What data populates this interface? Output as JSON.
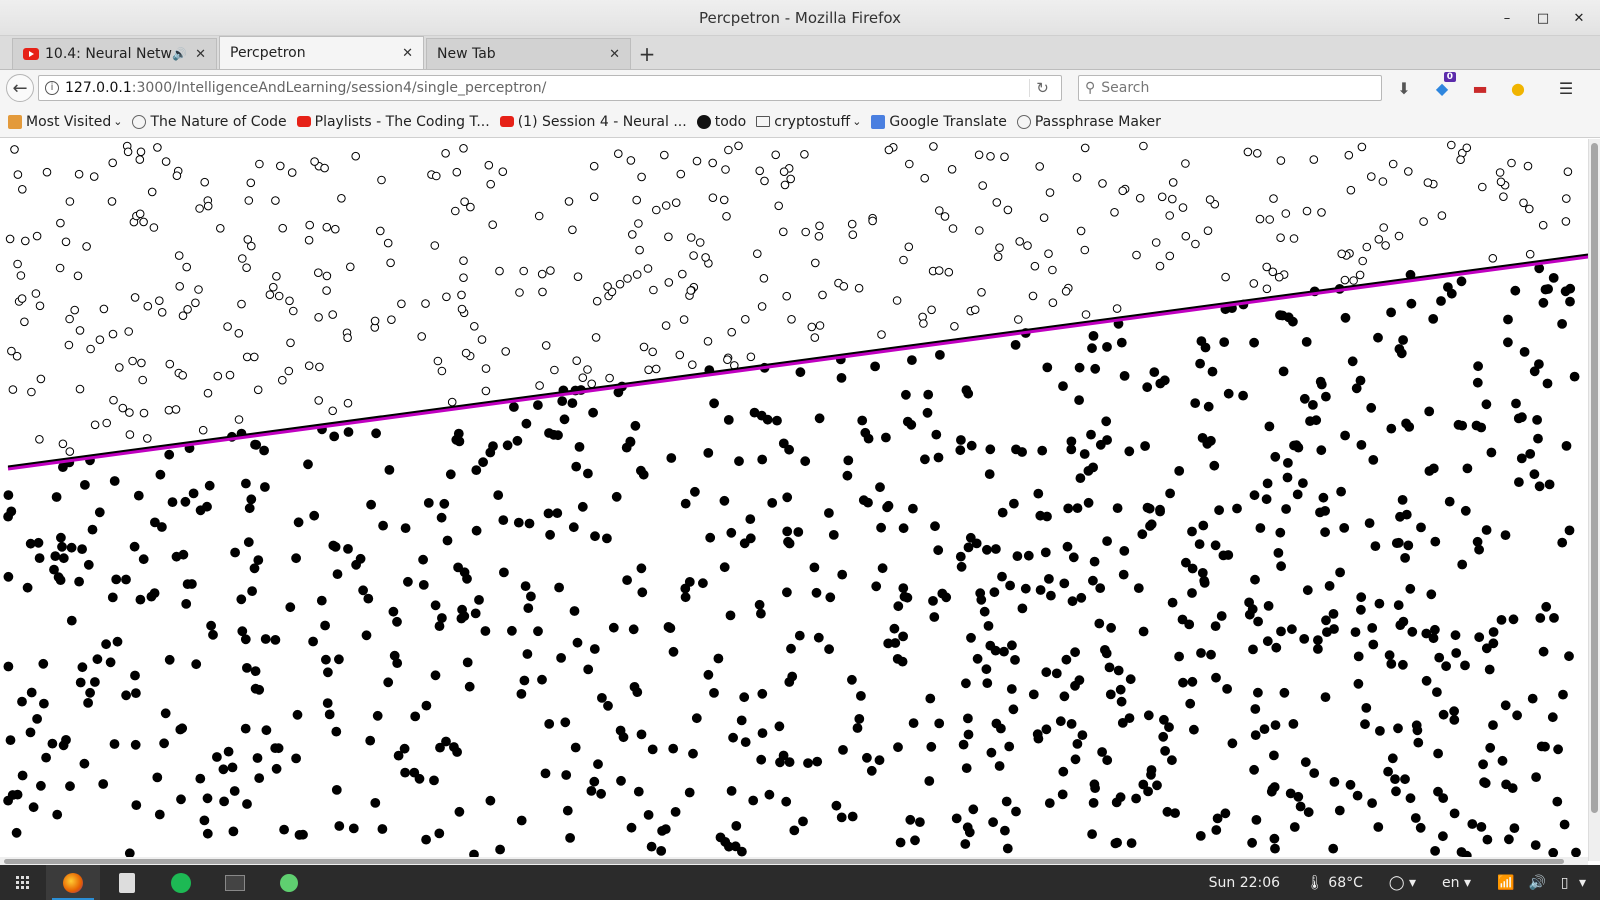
{
  "window": {
    "title": "Percpetron - Mozilla Firefox",
    "controls": [
      "–",
      "□",
      "✕"
    ]
  },
  "tabs": [
    {
      "label": "10.4: Neural Netw...",
      "active": false,
      "has_audio": true
    },
    {
      "label": "Percpetron",
      "active": true,
      "has_audio": false
    },
    {
      "label": "New Tab",
      "active": false,
      "has_audio": false
    }
  ],
  "nav": {
    "url_host": "127.0.0.1",
    "url_path": ":3000/IntelligenceAndLearning/session4/single_perceptron/",
    "search_placeholder": "Search",
    "notification_count": "0"
  },
  "bookmarks": [
    {
      "label": "Most Visited",
      "icon": "most-visited-icon",
      "dropdown": true
    },
    {
      "label": "The Nature of Code",
      "icon": "globe-icon"
    },
    {
      "label": "Playlists - The Coding T...",
      "icon": "youtube-icon"
    },
    {
      "label": "(1) Session 4 - Neural ...",
      "icon": "youtube-icon"
    },
    {
      "label": "todo",
      "icon": "github-icon"
    },
    {
      "label": "cryptostuff",
      "icon": "folder-icon",
      "dropdown": true
    },
    {
      "label": "Google Translate",
      "icon": "google-translate-icon"
    },
    {
      "label": "Passphrase Maker",
      "icon": "globe-icon"
    }
  ],
  "canvas": {
    "line_color": "#c000c0",
    "guess_line_color": "#000000"
  },
  "taskbar": {
    "clock": "Sun 22:06",
    "temperature": "68°C",
    "language": "en"
  }
}
